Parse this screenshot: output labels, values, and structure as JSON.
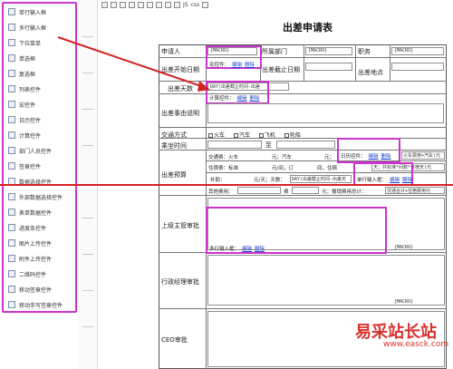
{
  "widgets": [
    {
      "label": "单行输入框",
      "icon": "text-input-icon"
    },
    {
      "label": "多行输入框",
      "icon": "textarea-icon"
    },
    {
      "label": "下拉菜单",
      "icon": "dropdown-icon"
    },
    {
      "label": "单选框",
      "icon": "radio-icon"
    },
    {
      "label": "复选框",
      "icon": "checkbox-icon"
    },
    {
      "label": "列表控件",
      "icon": "list-icon"
    },
    {
      "label": "宏控件",
      "icon": "macro-icon"
    },
    {
      "label": "日历控件",
      "icon": "calendar-icon"
    },
    {
      "label": "计算控件",
      "icon": "calculator-icon"
    },
    {
      "label": "部门人员控件",
      "icon": "department-icon"
    },
    {
      "label": "签章控件",
      "icon": "seal-icon"
    },
    {
      "label": "数据选择控件",
      "icon": "data-select-icon"
    },
    {
      "label": "外部数据选择控件",
      "icon": "external-data-icon"
    },
    {
      "label": "表单数据控件",
      "icon": "form-data-icon"
    },
    {
      "label": "进度条控件",
      "icon": "progress-icon"
    },
    {
      "label": "图片上传控件",
      "icon": "image-upload-icon"
    },
    {
      "label": "附件上传控件",
      "icon": "attachment-icon"
    },
    {
      "label": "二维码控件",
      "icon": "qrcode-icon"
    },
    {
      "label": "移动签章控件",
      "icon": "mobile-seal-icon"
    },
    {
      "label": "移动手写签章控件",
      "icon": "mobile-handwrite-icon"
    }
  ],
  "toolbar": {
    "text1": "JS",
    "text2": "css"
  },
  "form": {
    "title": "出差申请表",
    "macro": "{MACRO}",
    "applicant": "申请人",
    "department": "所属部门",
    "position": "职务",
    "start_date": "出差开始日期",
    "end_date": "出差截止日期",
    "location": "出差地点",
    "days": "出差天数",
    "days_formula": "DAY(出差截止时间-出差",
    "reason": "出差事由说明",
    "transport": "交通方式",
    "transport_options": [
      "火车",
      "汽车",
      "飞机",
      "轮船"
    ],
    "departure_time": "乘坐时间",
    "to": "至",
    "budget": "出差预算",
    "traffic_fee": "交通费：火车",
    "per_unit": "元；汽车",
    "per_unit2": "元；",
    "train_bus_formula": "火车费用+汽车(元",
    "lodging": "住宿费：标准",
    "per_night": "元/间，订",
    "per_night2": "间，住宿",
    "lodging_formula": "天；共标准*间数*住宿天(元",
    "subsidy": "补助：",
    "subsidy_rule": "元/天；天数：",
    "subsidy_formula": "DAY(出差截止时间-出差天",
    "other_fee": "其他费用：",
    "fee": "费",
    "yuan": "元；报销费用总计：",
    "total_formula": "交通合计+住宿费用元",
    "supervisor": "上级主管审批",
    "admin_manager": "行政经理审批",
    "ceo": "CEO审批",
    "macro_control": "宏控件：",
    "calc_control": "计算控件：",
    "calendar_control": "日历控件：",
    "single_input": "单行输入框：",
    "multi_input": "多行输入框：",
    "edit": "编辑",
    "delete": "删除"
  },
  "watermark": {
    "main": "易采站长站",
    "sub": "www.easck.com"
  },
  "colors": {
    "highlight": "#cc33cc",
    "arrow": "#d32424",
    "link": "#1a3fd1"
  }
}
